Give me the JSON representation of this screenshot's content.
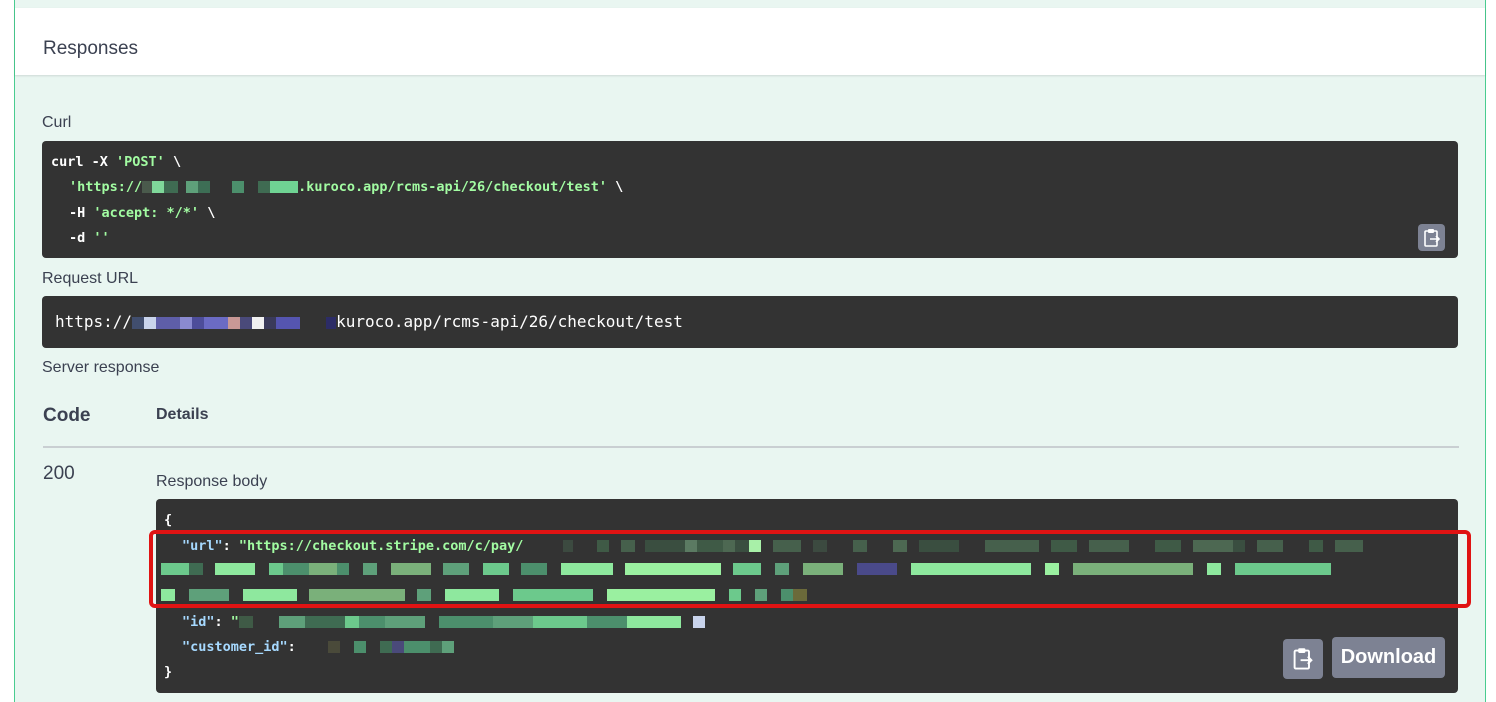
{
  "responses_title": "Responses",
  "curl": {
    "label": "Curl",
    "line1_cmd": "curl -X ",
    "line1_method": "'POST'",
    "line1_end": " \\",
    "line2_prefix": "'https://",
    "line2_suffix": ".kuroco.app/rcms-api/26/checkout/test'",
    "line2_end": " \\",
    "line3_flag": "-H ",
    "line3_value": "'accept: */*'",
    "line3_end": " \\",
    "line4_flag": "-d ",
    "line4_value": "''",
    "copy_icon": "clipboard-icon"
  },
  "request_url": {
    "label": "Request URL",
    "prefix": "https://",
    "suffix": "kuroco.app/rcms-api/26/checkout/test"
  },
  "server_response": {
    "label": "Server response",
    "code_header": "Code",
    "details_header": "Details",
    "code": "200",
    "body_label": "Response body",
    "open_brace": "{",
    "close_brace": "}",
    "url_key": "\"url\"",
    "url_value_prefix": "\"https://checkout.stripe.com/c/pay/",
    "id_key": "\"id\"",
    "id_value_prefix": "\"",
    "customer_key": "\"customer_id\"",
    "colon": ": ",
    "download_label": "Download",
    "copy_icon": "clipboard-icon"
  },
  "colors": {
    "border_green": "#49cc90",
    "panel_bg": "#e9f6f1",
    "code_bg": "#333333",
    "string_green": "#a2fca2",
    "key_blue": "#a6d9ff",
    "highlight_red": "#e01313",
    "button_gray": "#7d8293"
  }
}
